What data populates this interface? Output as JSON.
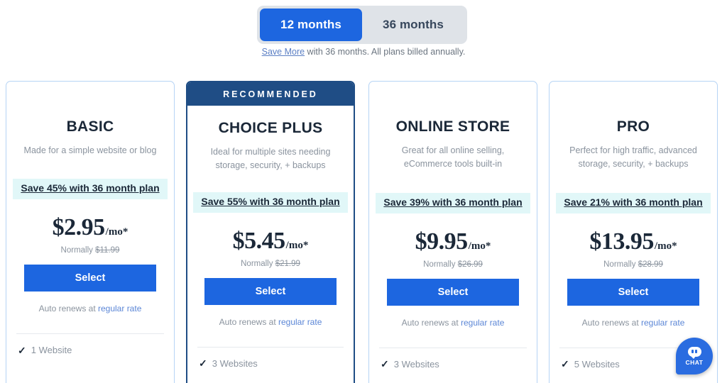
{
  "term_toggle": {
    "options": [
      {
        "label": "12 months",
        "active": true
      },
      {
        "label": "36 months",
        "active": false
      }
    ],
    "note_link": "Save More",
    "note_text": " with 36 months. All plans billed annually.",
    "active_color": "#1d66e0",
    "track_color": "#dfe3e8"
  },
  "plans": [
    {
      "name": "BASIC",
      "description": "Made for a simple website or blog",
      "recommended": false,
      "save_badge": "Save 45% with 36 month plan",
      "price": "$2.95",
      "price_unit": "/mo*",
      "normally_prefix": "Normally ",
      "normally_price": "$11.99",
      "select_label": "Select",
      "renew_prefix": "Auto renews at ",
      "renew_link": "regular rate",
      "check_icon": "✓",
      "feature": "1 Website"
    },
    {
      "name": "CHOICE PLUS",
      "description": "Ideal for multiple sites needing storage, security, + backups",
      "recommended": true,
      "recommended_label": "RECOMMENDED",
      "save_badge": "Save 55% with 36 month plan",
      "price": "$5.45",
      "price_unit": "/mo*",
      "normally_prefix": "Normally ",
      "normally_price": "$21.99",
      "select_label": "Select",
      "renew_prefix": "Auto renews at ",
      "renew_link": "regular rate",
      "check_icon": "✓",
      "feature": "3 Websites"
    },
    {
      "name": "ONLINE STORE",
      "description": "Great for all online selling, eCommerce tools built-in",
      "recommended": false,
      "save_badge": "Save 39% with 36 month plan",
      "price": "$9.95",
      "price_unit": "/mo*",
      "normally_prefix": "Normally ",
      "normally_price": "$26.99",
      "select_label": "Select",
      "renew_prefix": "Auto renews at ",
      "renew_link": "regular rate",
      "check_icon": "✓",
      "feature": "3 Websites"
    },
    {
      "name": "PRO",
      "description": "Perfect for high traffic, advanced storage, security, + backups",
      "recommended": false,
      "save_badge": "Save 21% with 36 month plan",
      "price": "$13.95",
      "price_unit": "/mo*",
      "normally_prefix": "Normally ",
      "normally_price": "$28.99",
      "select_label": "Select",
      "renew_prefix": "Auto renews at ",
      "renew_link": "regular rate",
      "check_icon": "✓",
      "feature": "5 Websites"
    }
  ],
  "chat_widget": {
    "label": "CHAT",
    "icon": "chat-bubble-icon",
    "color": "#2a6ce0"
  },
  "colors": {
    "brand_blue": "#1d66e0",
    "navy": "#1f4d85",
    "text_dark": "#1b2838",
    "text_muted": "#8a939e",
    "save_highlight": "#e1f7f8",
    "card_border": "#b6d4f5"
  }
}
